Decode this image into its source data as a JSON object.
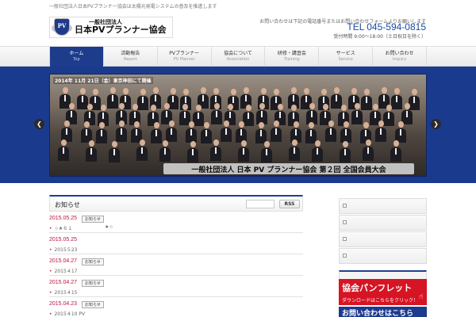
{
  "header": {
    "tagline": "一般社団法人日本PVプランナー協会は太陽光発電システムの普及を推進します",
    "logo": {
      "line1": "一般社団法人",
      "line2": "日本PVプランナー協会",
      "emblem_text": "PV"
    },
    "contact_note": "お問い合わせは下記の電話番号またはお問い合わせフォームよりお願いします",
    "tel": "TEL 045-594-0815",
    "hours": "受付時間 9:00～18:00（土日祝日を除く）"
  },
  "nav": {
    "items": [
      {
        "jp": "ホーム",
        "en": "Top",
        "active": true
      },
      {
        "jp": "活動報告",
        "en": "Report",
        "active": false
      },
      {
        "jp": "PVプランナー",
        "en": "PV Planner",
        "active": false
      },
      {
        "jp": "協会について",
        "en": "Association",
        "active": false
      },
      {
        "jp": "研修・講習会",
        "en": "Training",
        "active": false
      },
      {
        "jp": "サービス",
        "en": "Service",
        "active": false
      },
      {
        "jp": "お問い合わせ",
        "en": "Inquiry",
        "active": false
      }
    ]
  },
  "hero": {
    "date_caption": "2014年 11月 21日（金）東京神田にて開催",
    "banner": "一般社団法人 日本 PV プランナー協会 第２回 全国会員大会",
    "prev_label": "❮",
    "next_label": "❯"
  },
  "news": {
    "title": "お知らせ",
    "rss_label": "RSS",
    "items": [
      {
        "date": "2015.05.25",
        "badge": "お知らせ",
        "sub": "☆★６１",
        "extra": "★☆"
      },
      {
        "date": "2015.05.25",
        "badge": "",
        "sub": "2015５23",
        "extra": ""
      },
      {
        "date": "2015.04.27",
        "badge": "お知らせ",
        "sub": "2015４17",
        "extra": ""
      },
      {
        "date": "2015.04.27",
        "badge": "お知らせ",
        "sub": "2015４15",
        "extra": ""
      },
      {
        "date": "2015.04.23",
        "badge": "お知らせ",
        "sub": "2015４10 PV",
        "extra": ""
      }
    ]
  },
  "sidebar": {
    "pamphlet_title": "協会パンフレット",
    "pamphlet_sub": "ダウンロードはこちらをクリック！",
    "contact_title": "お問い合わせはこちら"
  },
  "colors": {
    "brand_blue": "#1d3c8c",
    "accent_red": "#d61423",
    "date_red": "#c0143c"
  }
}
